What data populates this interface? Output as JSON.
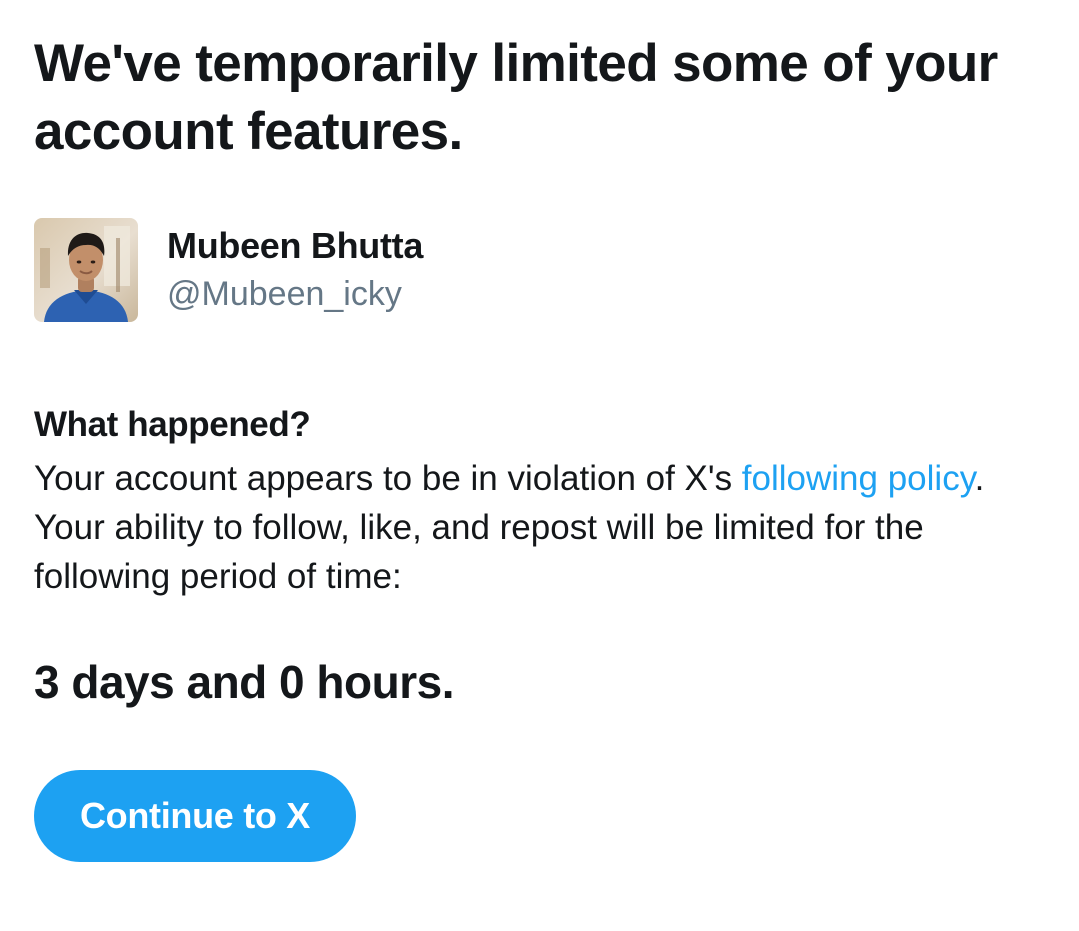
{
  "header": {
    "title": "We've temporarily limited some of your account features."
  },
  "account": {
    "display_name": "Mubeen Bhutta",
    "handle": "@Mubeen_icky"
  },
  "details": {
    "heading": "What happened?",
    "text_before_link": "Your account appears to be in violation of X's ",
    "link_text": "following policy",
    "text_after_link": ". Your ability to follow, like, and repost will be limited for the following period of time:"
  },
  "restriction": {
    "duration": "3 days and 0 hours."
  },
  "actions": {
    "continue_label": "Continue to X"
  },
  "colors": {
    "accent": "#1da1f2",
    "text": "#14171a",
    "secondary_text": "#657786"
  }
}
